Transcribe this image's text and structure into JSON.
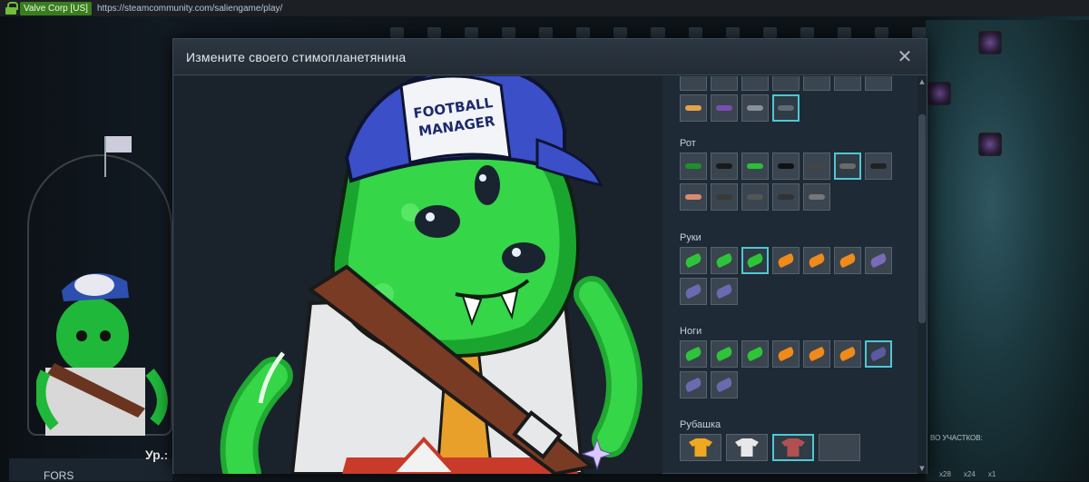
{
  "browser": {
    "ev_label": "Valve Corp [US]",
    "url": "https://steamcommunity.com/saliengame/play/"
  },
  "background": {
    "player_name": "FORS",
    "level_label": "Ур.:",
    "participants_label": "ВО УЧАСТКОВ:",
    "counts": [
      "x28",
      "x24",
      "x1"
    ]
  },
  "modal": {
    "title": "Измените своего стимопланетянина",
    "close_glyph": "✕"
  },
  "preview": {
    "cap_text_line1": "FOOTBALL",
    "cap_text_line2": "MANAGER"
  },
  "sections": {
    "top": {
      "items": 4,
      "selected": 3,
      "colors": [
        "#e8a24a",
        "#7a4fb0",
        "#8a9098",
        "#5d6a76"
      ]
    },
    "mouth": {
      "label": "Рот",
      "items": 12,
      "selected": 5,
      "colors": [
        "#1f8f2a",
        "#1a1a1a",
        "#2bbf34",
        "#111111",
        "#444444",
        "#6a6a6a",
        "#222222",
        "#d98a70",
        "#3a3a3a",
        "#555555",
        "#333333",
        "#777777"
      ]
    },
    "hands": {
      "label": "Руки",
      "items": 9,
      "selected": 2,
      "colors": [
        "#2ec43a",
        "#2ec43a",
        "#2ec43a",
        "#f08a1a",
        "#f08a1a",
        "#f08a1a",
        "#7a6ab8",
        "#6a6ab0",
        "#6a6ab0"
      ]
    },
    "legs": {
      "label": "Ноги",
      "items": 9,
      "selected": 6,
      "colors": [
        "#2ec43a",
        "#2ec43a",
        "#2ec43a",
        "#f08a1a",
        "#f08a1a",
        "#f08a1a",
        "#5a5aa0",
        "#6a6ab0",
        "#6a6ab0"
      ]
    },
    "shirt": {
      "label": "Рубашка",
      "items": 4,
      "selected": 2,
      "colors": [
        "#f0a820",
        "#e8e8e8",
        "#b05050",
        "#3a4550"
      ]
    }
  }
}
